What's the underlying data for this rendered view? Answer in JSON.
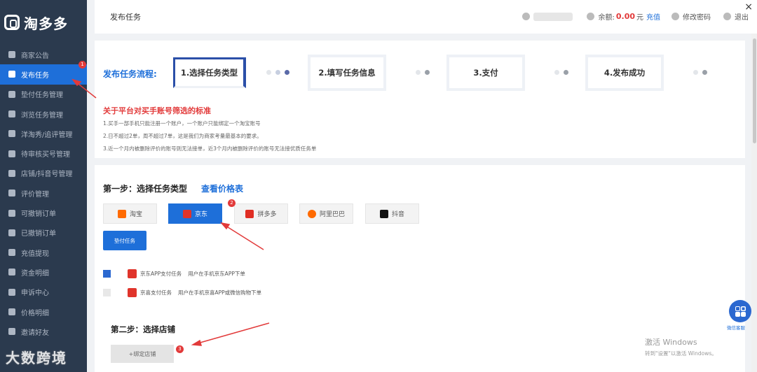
{
  "sidebar": {
    "brand": "淘多多",
    "items": [
      {
        "label": "商家公告",
        "icon": "announcement-icon"
      },
      {
        "label": "发布任务",
        "icon": "document-icon",
        "active": true
      },
      {
        "label": "垫付任务管理",
        "icon": "pay-icon"
      },
      {
        "label": "浏览任务管理",
        "icon": "eye-icon"
      },
      {
        "label": "洋淘秀/追评管理",
        "icon": "comment-icon"
      },
      {
        "label": "待审核买号管理",
        "icon": "user-icon"
      },
      {
        "label": "店铺/抖音号管理",
        "icon": "store-icon"
      },
      {
        "label": "评价管理",
        "icon": "star-icon"
      },
      {
        "label": "可撤销订单",
        "icon": "order-icon"
      },
      {
        "label": "已撤销订单",
        "icon": "order-cancel-icon"
      },
      {
        "label": "充值提现",
        "icon": "money-icon"
      },
      {
        "label": "资金明细",
        "icon": "ledger-icon"
      },
      {
        "label": "申诉中心",
        "icon": "appeal-icon"
      },
      {
        "label": "价格明细",
        "icon": "price-icon"
      },
      {
        "label": "邀请好友",
        "icon": "invite-icon"
      }
    ],
    "badge": "1"
  },
  "header": {
    "title": "发布任务",
    "balance_label": "余额:",
    "balance_value": "0.00",
    "balance_unit": "元",
    "recharge": "充值",
    "change_password": "修改密码",
    "logout": "退出",
    "close": "×"
  },
  "flow": {
    "label": "发布任务流程:",
    "steps": [
      "1.选择任务类型",
      "2.填写任务信息",
      "3.支付",
      "4.发布成功"
    ]
  },
  "rules": {
    "title": "关于平台对买手账号筛选的标准",
    "lines": [
      "1.买手一部手机只能注册一个账户，一个账户只能绑定一个淘宝账号",
      "2.日不超过2单，周不超过7单，这是我们为商家考量最基本的要求。",
      "3.近一个月内被删除评价的账号则无法接单，近3个月内被删除评价的账号无法接优质任务单"
    ]
  },
  "step1": {
    "title": "第一步：选择任务类型",
    "price_link": "查看价格表",
    "platforms": [
      {
        "label": "淘宝",
        "color": "#ff6a00"
      },
      {
        "label": "京东",
        "color": "#e0342b",
        "active": true
      },
      {
        "label": "拼多多",
        "color": "#e02e24"
      },
      {
        "label": "阿里巴巴",
        "color": "#ff6a00"
      },
      {
        "label": "抖音",
        "color": "#111111"
      }
    ],
    "badge": "2",
    "advance_button": "垫付任务",
    "tasks": [
      {
        "name": "京东APP支付任务",
        "desc": "用户在手机京东APP下单",
        "checked": true
      },
      {
        "name": "京喜支付任务",
        "desc": "用户在手机京喜APP或微信购物下单",
        "checked": false
      }
    ]
  },
  "step2": {
    "title": "第二步：选择店铺",
    "bind_button": "+绑定店铺",
    "badge": "3"
  },
  "service": {
    "label": "微信客服"
  },
  "watermark": {
    "windows_line1": "激活 Windows",
    "windows_line2": "转到\"设置\"以激活 Windows。",
    "corner": "大数跨境"
  }
}
